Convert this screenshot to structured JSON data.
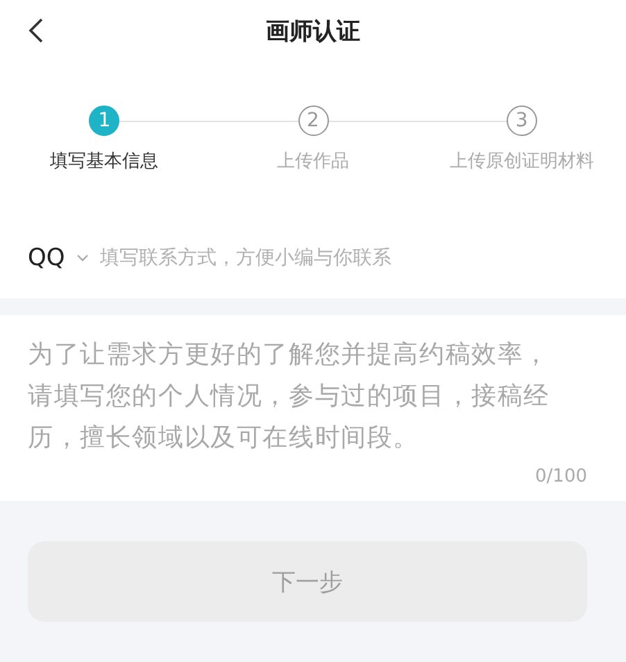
{
  "header": {
    "title": "画师认证"
  },
  "steps": [
    {
      "number": "1",
      "label": "填写基本信息",
      "selected": true
    },
    {
      "number": "2",
      "label": "上传作品",
      "selected": false
    },
    {
      "number": "3",
      "label": "上传原创证明材料",
      "selected": false
    }
  ],
  "contact": {
    "type": "QQ",
    "placeholder": "填写联系方式，方便小编与你联系"
  },
  "intro": {
    "placeholder": "为了让需求方更好的了解您并提高约稿效率，请填写您的个人情况，参与过的项目，接稿经历，擅长领域以及可在线时间段。",
    "counter": "0/100"
  },
  "next_button": {
    "label": "下一步",
    "disabled": true
  }
}
